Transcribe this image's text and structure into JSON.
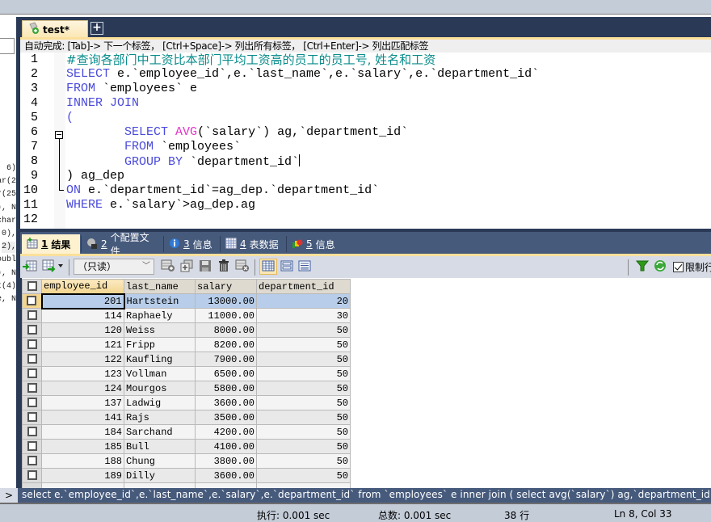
{
  "editor": {
    "tab_title": "test*",
    "add_tab_label": "+",
    "autocomplete_hint": "自动完成:  [Tab]-> 下一个标签，  [Ctrl+Space]-> 列出所有标签，  [Ctrl+Enter]-> 列出匹配标签",
    "line_numbers": [
      "1",
      "2",
      "3",
      "4",
      "5",
      "6",
      "7",
      "8",
      "9",
      "10",
      "11",
      "12"
    ],
    "lines": [
      [
        {
          "t": "#查询各部门中工资比本部门平均工资高的员工的员工号, 姓名和工资",
          "c": "cm"
        }
      ],
      [
        {
          "t": "SELECT",
          "c": "kw"
        },
        {
          "t": " e.`employee_id`,e.`last_name`,e.`salary`,e.`department_id`",
          "c": ""
        }
      ],
      [
        {
          "t": "FROM",
          "c": "kw"
        },
        {
          "t": " `employees` e",
          "c": ""
        }
      ],
      [
        {
          "t": "INNER JOIN",
          "c": "kw"
        }
      ],
      [
        {
          "t": "(",
          "c": "kw"
        }
      ],
      [
        {
          "t": "        ",
          "c": ""
        },
        {
          "t": "SELECT",
          "c": "kw"
        },
        {
          "t": " ",
          "c": ""
        },
        {
          "t": "AVG",
          "c": "fn"
        },
        {
          "t": "(`salary`) ag,`department_id`",
          "c": ""
        }
      ],
      [
        {
          "t": "        ",
          "c": ""
        },
        {
          "t": "FROM",
          "c": "kw"
        },
        {
          "t": " `employees`",
          "c": ""
        }
      ],
      [
        {
          "t": "        ",
          "c": ""
        },
        {
          "t": "GROUP BY",
          "c": "kw"
        },
        {
          "t": " `department_id`",
          "c": ""
        }
      ],
      [
        {
          "t": ") ag_dep",
          "c": ""
        }
      ],
      [
        {
          "t": "ON",
          "c": "kw"
        },
        {
          "t": " e.`department_id`=ag_dep.`department_id`",
          "c": ""
        }
      ],
      [
        {
          "t": "WHERE",
          "c": "kw"
        },
        {
          "t": " e.`salary`>ag_dep.ag",
          "c": ""
        }
      ],
      [
        {
          "t": "",
          "c": ""
        }
      ]
    ]
  },
  "left_panel": {
    "fragments": [
      "6)",
      "ar(2",
      "r(25",
      "), N",
      "char",
      "0),",
      " 2),",
      "oubl",
      "), N",
      "t(4)",
      "e, N"
    ]
  },
  "result_tabs": [
    {
      "num": "1",
      "label": "结果",
      "icon": "result-grid-icon",
      "active": true
    },
    {
      "num": "2",
      "label": "个配置文件",
      "icon": "profile-icon",
      "active": false
    },
    {
      "num": "3",
      "label": "信息",
      "icon": "info-icon",
      "active": false
    },
    {
      "num": "4",
      "label": "表数据",
      "icon": "table-data-icon",
      "active": false
    },
    {
      "num": "5",
      "label": "信息",
      "icon": "info-chart-icon",
      "active": false
    }
  ],
  "toolbar": {
    "mode_select": "（只读）",
    "limit_rows_label": "限制行",
    "limit_rows_checked": true
  },
  "grid": {
    "columns": [
      "employee_id",
      "last_name",
      "salary",
      "department_id"
    ],
    "rows": [
      [
        "201",
        "Hartstein",
        "13000.00",
        "20"
      ],
      [
        "114",
        "Raphaely",
        "11000.00",
        "30"
      ],
      [
        "120",
        "Weiss",
        "8000.00",
        "50"
      ],
      [
        "121",
        "Fripp",
        "8200.00",
        "50"
      ],
      [
        "122",
        "Kaufling",
        "7900.00",
        "50"
      ],
      [
        "123",
        "Vollman",
        "6500.00",
        "50"
      ],
      [
        "124",
        "Mourgos",
        "5800.00",
        "50"
      ],
      [
        "137",
        "Ladwig",
        "3600.00",
        "50"
      ],
      [
        "141",
        "Rajs",
        "3500.00",
        "50"
      ],
      [
        "184",
        "Sarchand",
        "4200.00",
        "50"
      ],
      [
        "185",
        "Bull",
        "4100.00",
        "50"
      ],
      [
        "188",
        "Chung",
        "3800.00",
        "50"
      ],
      [
        "189",
        "Dilly",
        "3600.00",
        "50"
      ]
    ]
  },
  "sql_line": {
    "expander": ">",
    "text": "select e.`employee_id`,e.`last_name`,e.`salary`,e.`department_id` from `employees` e inner join ( select avg(`salary`) ag,`department_id` from"
  },
  "status": {
    "exec_time": "执行: 0.001 sec",
    "total_time": "总数: 0.001 sec",
    "rows": "38 行",
    "cursor": "Ln 8, Col 33"
  }
}
